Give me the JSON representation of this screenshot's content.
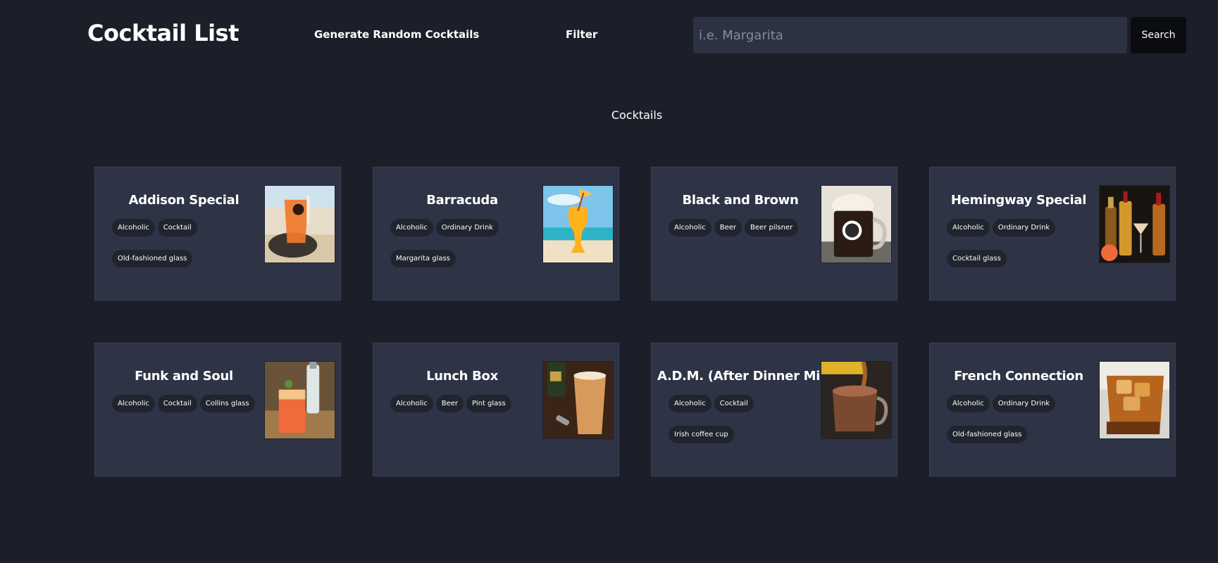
{
  "header": {
    "brand": "Cocktail List",
    "nav": {
      "random": "Generate Random Cocktails",
      "filter": "Filter"
    },
    "search": {
      "placeholder": "i.e. Margarita",
      "value": "",
      "button": "Search"
    }
  },
  "section_title": "Cocktails",
  "cards": [
    {
      "name": "Addison Special",
      "tags": [
        "Alcoholic",
        "Cocktail",
        "Old-fashioned glass"
      ],
      "image_icon": "orange-drink-beach-icon"
    },
    {
      "name": "Barracuda",
      "tags": [
        "Alcoholic",
        "Ordinary Drink",
        "Margarita glass"
      ],
      "image_icon": "hurricane-glass-beach-icon"
    },
    {
      "name": "Black and Brown",
      "tags": [
        "Alcoholic",
        "Beer",
        "Beer pilsner"
      ],
      "image_icon": "beer-mug-icon"
    },
    {
      "name": "Hemingway Special",
      "tags": [
        "Alcoholic",
        "Ordinary Drink",
        "Cocktail glass"
      ],
      "image_icon": "bottles-martini-icon"
    },
    {
      "name": "Funk and Soul",
      "tags": [
        "Alcoholic",
        "Cocktail",
        "Collins glass"
      ],
      "image_icon": "collins-glass-icon"
    },
    {
      "name": "Lunch Box",
      "tags": [
        "Alcoholic",
        "Beer",
        "Pint glass"
      ],
      "image_icon": "pint-glass-icon"
    },
    {
      "name": "A.D.M. (After Dinner Mint)",
      "tags": [
        "Alcoholic",
        "Cocktail",
        "Irish coffee cup"
      ],
      "image_icon": "irish-coffee-cup-icon"
    },
    {
      "name": "French Connection",
      "tags": [
        "Alcoholic",
        "Ordinary Drink",
        "Old-fashioned glass"
      ],
      "image_icon": "rocks-glass-icon"
    }
  ],
  "colors": {
    "background": "#1c1f2a",
    "card": "#2e3445",
    "tag": "#20242f",
    "input": "#2d3242",
    "search_button": "#0b0c0f"
  }
}
